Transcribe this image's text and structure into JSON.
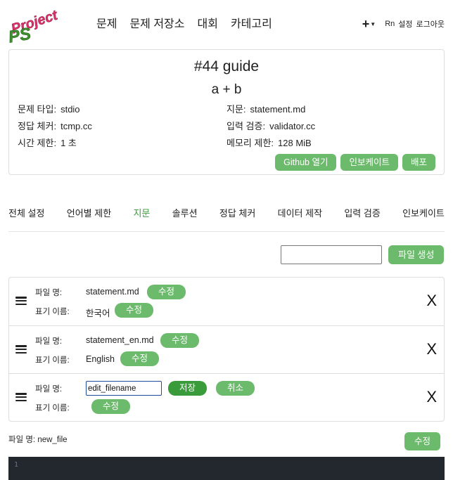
{
  "header": {
    "logo_top": "Project",
    "logo_bottom": "PS",
    "nav": [
      "문제",
      "문제 저장소",
      "대회",
      "카테고리"
    ],
    "plus_label": "+",
    "user": "Rn",
    "settings": "설정",
    "logout": "로그아웃"
  },
  "problem": {
    "title": "#44 guide",
    "name": "a + b",
    "type_label": "문제 타입:",
    "type_value": "stdio",
    "checker_label": "정답 체커:",
    "checker_value": "tcmp.cc",
    "time_label": "시간 제한:",
    "time_value": "1 초",
    "statement_label": "지문:",
    "statement_value": "statement.md",
    "validator_label": "입력 검증:",
    "validator_value": "validator.cc",
    "memory_label": "메모리 제한:",
    "memory_value": "128 MiB",
    "actions": [
      "Github 열기",
      "인보케이트",
      "배포"
    ]
  },
  "tabs": [
    "전체 설정",
    "언어별 제한",
    "지문",
    "솔루션",
    "정답 체커",
    "데이터 제작",
    "입력 검증",
    "인보케이트"
  ],
  "active_tab": "지문",
  "new_file": {
    "value": "",
    "button": "파일 생성"
  },
  "files": [
    {
      "filename_label": "파일 명:",
      "filename": "statement.md",
      "display_label": "표기 이름:",
      "display": "한국어",
      "edit": "수정",
      "remove": "X"
    },
    {
      "filename_label": "파일 명:",
      "filename": "statement_en.md",
      "display_label": "표기 이름:",
      "display": "English",
      "edit": "수정",
      "remove": "X"
    },
    {
      "filename_label": "파일 명:",
      "filename_input": "edit_filename",
      "save": "저장",
      "cancel": "취소",
      "display_label": "표기 이름:",
      "edit": "수정",
      "remove": "X"
    }
  ],
  "current_file": "파일 명: new_file",
  "bottom_edit": "수정",
  "editor": {
    "line_numbers": [
      "1"
    ]
  },
  "colors": {
    "accent": "#6cba6c",
    "accent_dark": "#3a9b3a",
    "editor_bg": "#23272e",
    "logo_green": "#3f8f2f",
    "logo_red": "#d9326b"
  }
}
